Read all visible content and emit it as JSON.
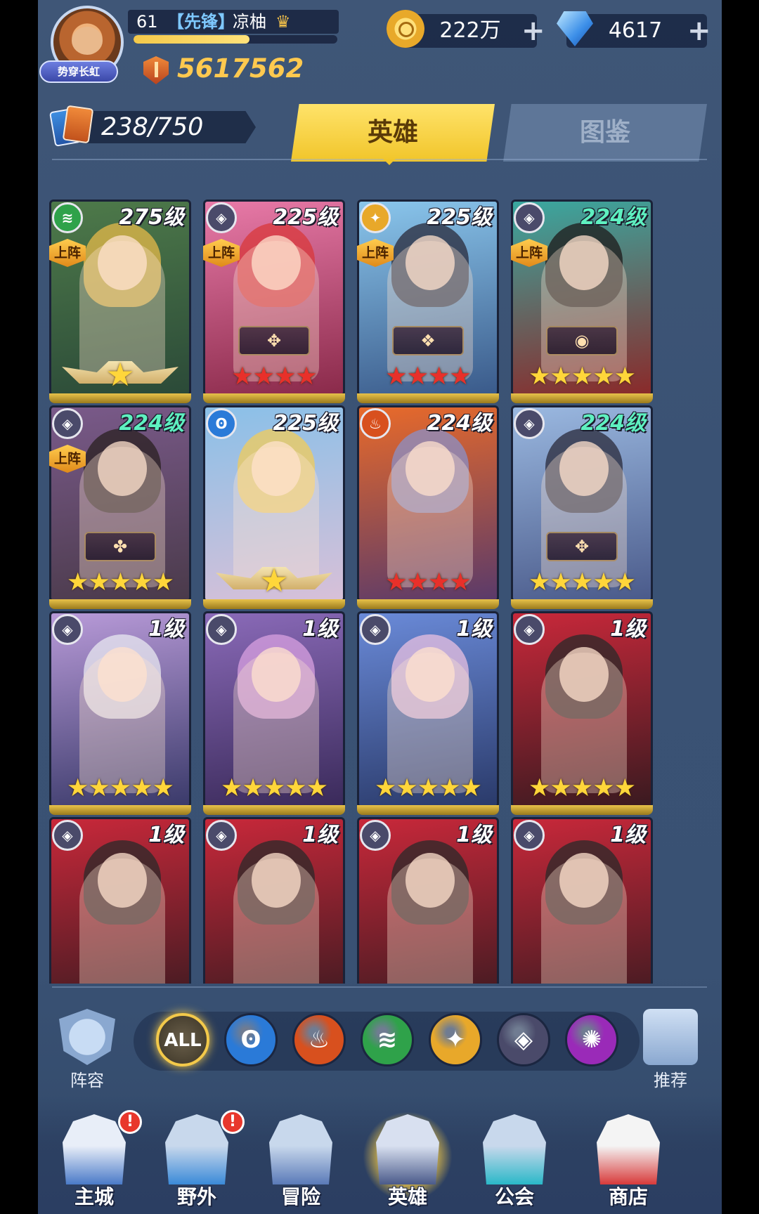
{
  "player": {
    "avatar_badge": "势穿长虹",
    "level": "61",
    "guild": "【先锋】",
    "name": "凉柚",
    "xp_fraction": 0.57,
    "power": "5617562"
  },
  "currency": {
    "gold": "222万",
    "gems": "4617",
    "plus": "+"
  },
  "collection": {
    "count": "238/750"
  },
  "tabs": [
    {
      "label": "英雄",
      "active": true
    },
    {
      "label": "图鉴",
      "active": false
    }
  ],
  "deployed_label": "上阵",
  "heroes": [
    {
      "level": "275级",
      "element": "wind",
      "deployed": true,
      "stars": 1,
      "star_color": "gold",
      "winged": true,
      "level_color": "#ffffff",
      "bg": [
        "#4e7a4a",
        "#2b4a38"
      ],
      "hair": "#e6b94a"
    },
    {
      "level": "225级",
      "element": "dark",
      "deployed": true,
      "stars": 4,
      "star_color": "red",
      "winged": false,
      "level_color": "#ffffff",
      "bg": [
        "#e87aa8",
        "#8a2a4a"
      ],
      "hair": "#d8383a",
      "rank": "✥"
    },
    {
      "level": "225级",
      "element": "light",
      "deployed": true,
      "stars": 4,
      "star_color": "red",
      "winged": false,
      "level_color": "#ffffff",
      "bg": [
        "#8ac6ec",
        "#3a5a8a"
      ],
      "hair": "#2a2a3a",
      "rank": "❖"
    },
    {
      "level": "224级",
      "element": "dark",
      "deployed": true,
      "stars": 5,
      "star_color": "gold",
      "winged": false,
      "level_color": "#5ef0c0",
      "bg": [
        "#3aa8a0",
        "#8a2a2a"
      ],
      "hair": "#1e1a1a",
      "rank": "◉"
    },
    {
      "level": "224级",
      "element": "dark",
      "deployed": true,
      "stars": 5,
      "star_color": "gold",
      "winged": false,
      "level_color": "#5ef0c0",
      "bg": [
        "#7a5a8a",
        "#4a3a4a"
      ],
      "hair": "#2a2020",
      "rank": "✤"
    },
    {
      "level": "225级",
      "element": "water",
      "deployed": false,
      "stars": 1,
      "star_color": "gold",
      "winged": true,
      "level_color": "#ffffff",
      "bg": [
        "#8ac0e8",
        "#d8c0d8"
      ],
      "hair": "#f2cc5a"
    },
    {
      "level": "224级",
      "element": "fire",
      "deployed": false,
      "stars": 4,
      "star_color": "red",
      "winged": false,
      "level_color": "#ffffff",
      "bg": [
        "#e86a2a",
        "#5a3a6a"
      ],
      "hair": "#8a90c8"
    },
    {
      "level": "224级",
      "element": "dark",
      "deployed": false,
      "stars": 5,
      "star_color": "gold",
      "winged": false,
      "level_color": "#5ef0c0",
      "bg": [
        "#9ab8e0",
        "#4a5a8a"
      ],
      "hair": "#2a2a3a",
      "rank": "✥"
    },
    {
      "level": "1级",
      "element": "dark",
      "deployed": false,
      "stars": 5,
      "star_color": "gold",
      "winged": false,
      "level_color": "#ffffff",
      "bg": [
        "#b89ad8",
        "#3a3a6a"
      ],
      "hair": "#e8e8f0"
    },
    {
      "level": "1级",
      "element": "dark",
      "deployed": false,
      "stars": 5,
      "star_color": "gold",
      "winged": false,
      "level_color": "#ffffff",
      "bg": [
        "#8a6ab8",
        "#3a2a5a"
      ],
      "hair": "#d8a0e0"
    },
    {
      "level": "1级",
      "element": "dark",
      "deployed": false,
      "stars": 5,
      "star_color": "gold",
      "winged": false,
      "level_color": "#ffffff",
      "bg": [
        "#6a8ad8",
        "#2a3a6a"
      ],
      "hair": "#e8c0e0"
    },
    {
      "level": "1级",
      "element": "dark",
      "deployed": false,
      "stars": 5,
      "star_color": "gold",
      "winged": false,
      "level_color": "#ffffff",
      "bg": [
        "#c8283a",
        "#3a1a20"
      ],
      "hair": "#2a2a2a"
    },
    {
      "level": "1级",
      "element": "dark",
      "deployed": false,
      "stars": 0,
      "star_color": "gold",
      "winged": false,
      "level_color": "#ffffff",
      "bg": [
        "#c8283a",
        "#3a1a20"
      ],
      "hair": "#2a2a2a"
    },
    {
      "level": "1级",
      "element": "dark",
      "deployed": false,
      "stars": 0,
      "star_color": "gold",
      "winged": false,
      "level_color": "#ffffff",
      "bg": [
        "#c8283a",
        "#3a1a20"
      ],
      "hair": "#2a2a2a"
    },
    {
      "level": "1级",
      "element": "dark",
      "deployed": false,
      "stars": 0,
      "star_color": "gold",
      "winged": false,
      "level_color": "#ffffff",
      "bg": [
        "#c8283a",
        "#3a1a20"
      ],
      "hair": "#2a2a2a"
    },
    {
      "level": "1级",
      "element": "dark",
      "deployed": false,
      "stars": 0,
      "star_color": "gold",
      "winged": false,
      "level_color": "#ffffff",
      "bg": [
        "#c8283a",
        "#3a1a20"
      ],
      "hair": "#2a2a2a"
    }
  ],
  "elements": {
    "wind": {
      "color": "#2fa24a",
      "glyph": "≋"
    },
    "dark": {
      "color": "#4a4a6a",
      "glyph": "◈"
    },
    "light": {
      "color": "#e8a82a",
      "glyph": "✦"
    },
    "water": {
      "color": "#2a7ad8",
      "glyph": "ʘ"
    },
    "fire": {
      "color": "#d8501e",
      "glyph": "♨"
    },
    "arcane": {
      "color": "#9a2ab8",
      "glyph": "✺"
    }
  },
  "filters": {
    "lineup_label": "阵容",
    "recommend_label": "推荐",
    "all_label": "ALL",
    "buttons": [
      "all",
      "water",
      "fire",
      "wind",
      "light",
      "dark",
      "arcane"
    ]
  },
  "nav": [
    {
      "label": "主城",
      "badge": "!",
      "icon": "castle-icon",
      "active": false
    },
    {
      "label": "野外",
      "badge": "!",
      "icon": "portal-icon",
      "active": false
    },
    {
      "label": "冒险",
      "badge": "",
      "icon": "sword-icon",
      "active": false
    },
    {
      "label": "英雄",
      "badge": "",
      "icon": "helmet-icon",
      "active": true
    },
    {
      "label": "公会",
      "badge": "",
      "icon": "banner-icon",
      "active": false
    },
    {
      "label": "商店",
      "badge": "",
      "icon": "shop-icon",
      "active": false
    }
  ]
}
